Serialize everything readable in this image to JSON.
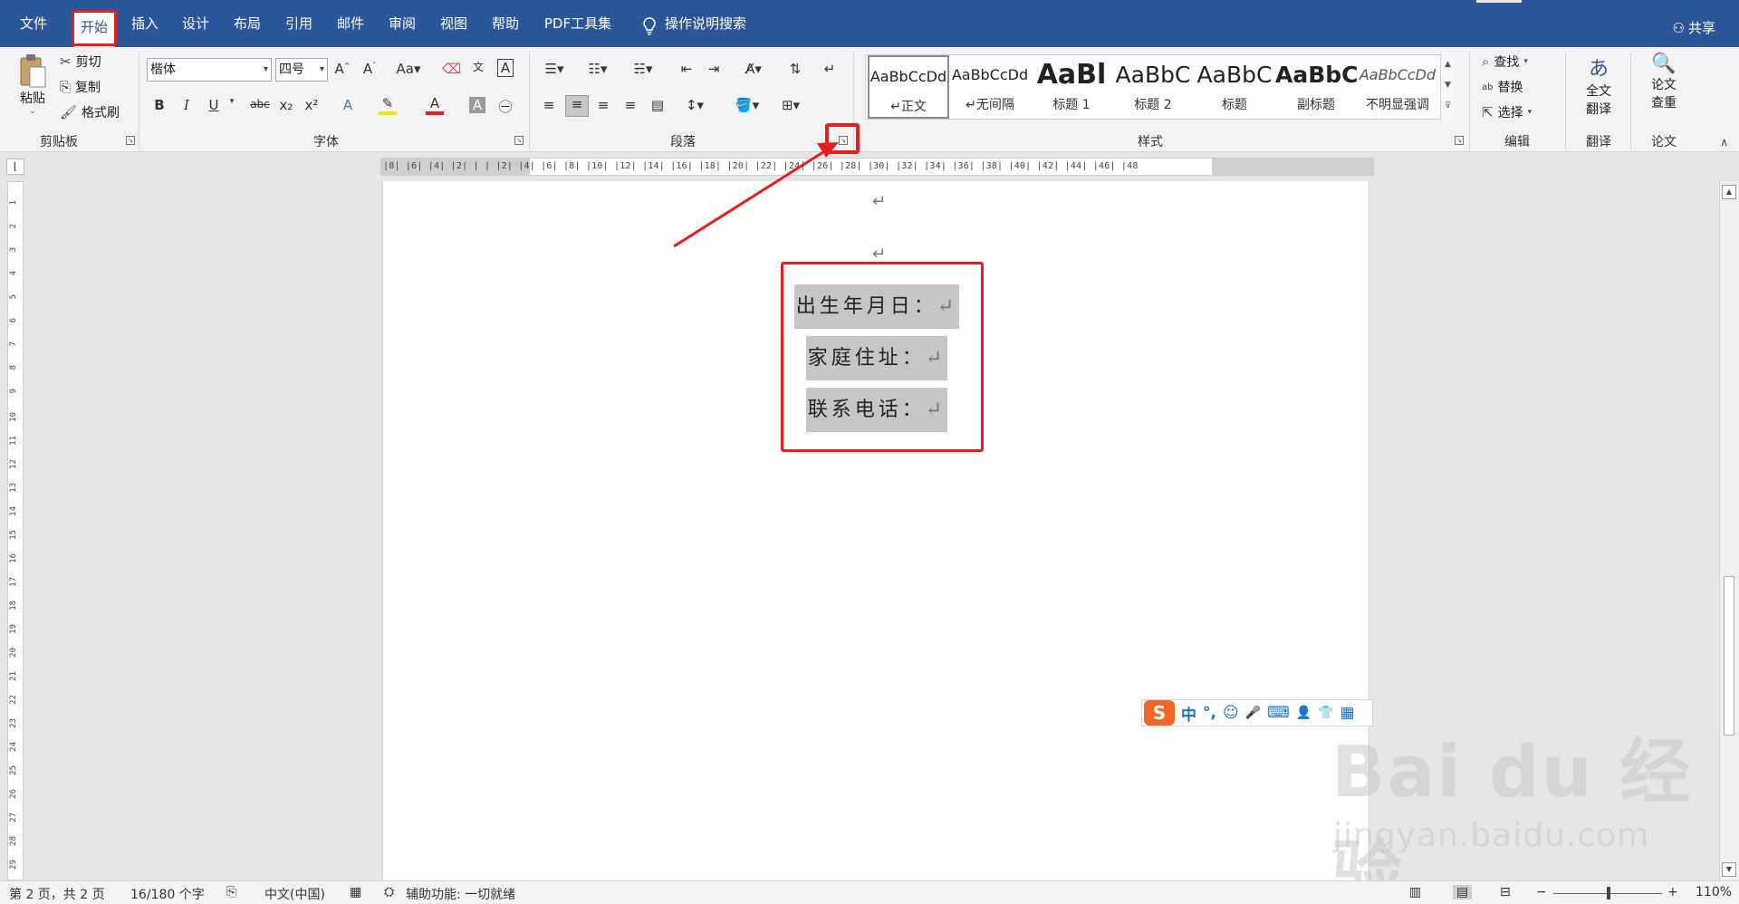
{
  "tabs": [
    "文件",
    "开始",
    "插入",
    "设计",
    "布局",
    "引用",
    "邮件",
    "审阅",
    "视图",
    "帮助",
    "PDF工具集",
    "操作说明搜索"
  ],
  "share": "共享",
  "clipboard": {
    "paste": "粘贴",
    "cut": "剪切",
    "copy": "复制",
    "format_painter": "格式刷",
    "label": "剪贴板"
  },
  "font": {
    "name": "楷体",
    "size": "四号",
    "label": "字体",
    "bold": "B",
    "italic": "I",
    "underline": "U",
    "strike": "abc",
    "sub": "x₂",
    "sup": "x²",
    "font_color": "A"
  },
  "paragraph": {
    "label": "段落"
  },
  "styles": {
    "label": "样式",
    "items": [
      {
        "sample": "AaBbCcDd",
        "name": "↵正文"
      },
      {
        "sample": "AaBbCcDd",
        "name": "↵无间隔"
      },
      {
        "sample": "AaBl",
        "name": "标题 1"
      },
      {
        "sample": "AaBbC",
        "name": "标题 2"
      },
      {
        "sample": "AaBbC",
        "name": "标题"
      },
      {
        "sample": "AaBbC",
        "name": "副标题"
      },
      {
        "sample": "AaBbCcDd",
        "name": "不明显强调"
      }
    ]
  },
  "editing": {
    "find": "查找",
    "replace": "替换",
    "select": "选择",
    "label": "编辑"
  },
  "translate": {
    "btn": "全文翻译",
    "btn_line1": "全文",
    "btn_line2": "翻译",
    "label": "翻译"
  },
  "paper": {
    "btn_line1": "论文",
    "btn_line2": "查重",
    "label": "论文"
  },
  "ruler": {
    "top": "|8|  |6|  |4|  |2|  |  |  |2|  |4|  |6|  |8|  |10| |12| |14| |16| |18| |20| |22| |24| |26| |28| |30| |32| |34| |36| |38| |40| |42| |44| |46| |48"
  },
  "document": {
    "lines": [
      "出生年月日：",
      "家庭住址：",
      "联系电话："
    ],
    "para_mark": "↵"
  },
  "ime": {
    "logo": "S",
    "items": [
      "中",
      "°,",
      "☺",
      "🎤",
      "⌨",
      "👤",
      "👕",
      "▦"
    ]
  },
  "watermark": {
    "big": "Bai du 经验",
    "small": "jingyan.baidu.com"
  },
  "status": {
    "page": "第 2 页，共 2 页",
    "words": "16/180 个字",
    "lang": "中文(中国)",
    "access": "辅助功能: 一切就绪",
    "zoom": "110%"
  }
}
